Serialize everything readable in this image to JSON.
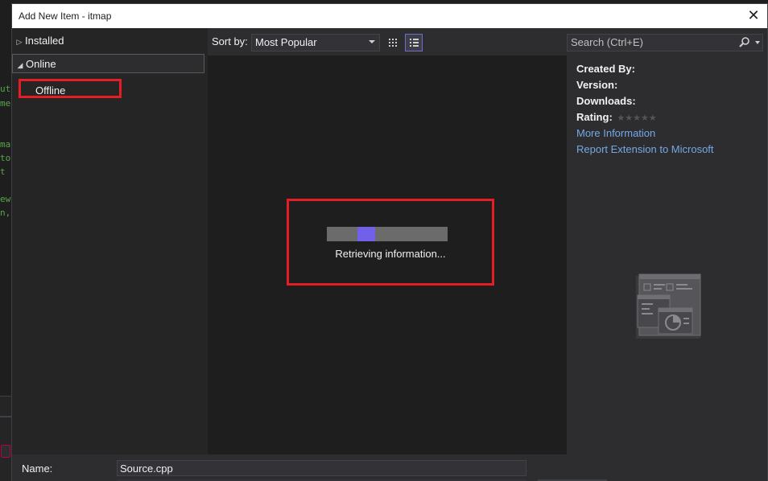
{
  "background_editor": {
    "code_lines": [
      "ut",
      "me",
      "mai",
      "to",
      "t a",
      "ew",
      "n,"
    ]
  },
  "dialog": {
    "title": "Add New Item - itmap",
    "close_label": "✕"
  },
  "tree": {
    "installed_label": "Installed",
    "online_label": "Online",
    "offline_label": "Offline"
  },
  "toolbar": {
    "sort_by_label": "Sort by:",
    "sort_selected": "Most Popular"
  },
  "loading": {
    "progress_fraction": 0.25,
    "text": "Retrieving information..."
  },
  "search": {
    "placeholder": "Search (Ctrl+E)"
  },
  "details": {
    "created_by_label": "Created By:",
    "version_label": "Version:",
    "downloads_label": "Downloads:",
    "rating_label": "Rating:",
    "rating_stars": "★★★★★",
    "more_info_link": "More Information",
    "report_link": "Report Extension to Microsoft"
  },
  "footer": {
    "name_label": "Name:",
    "name_value": "Source.cpp"
  },
  "colors": {
    "highlight_red": "#e51e25",
    "progress_accent": "#7160e8",
    "link_blue": "#75a8e5"
  }
}
